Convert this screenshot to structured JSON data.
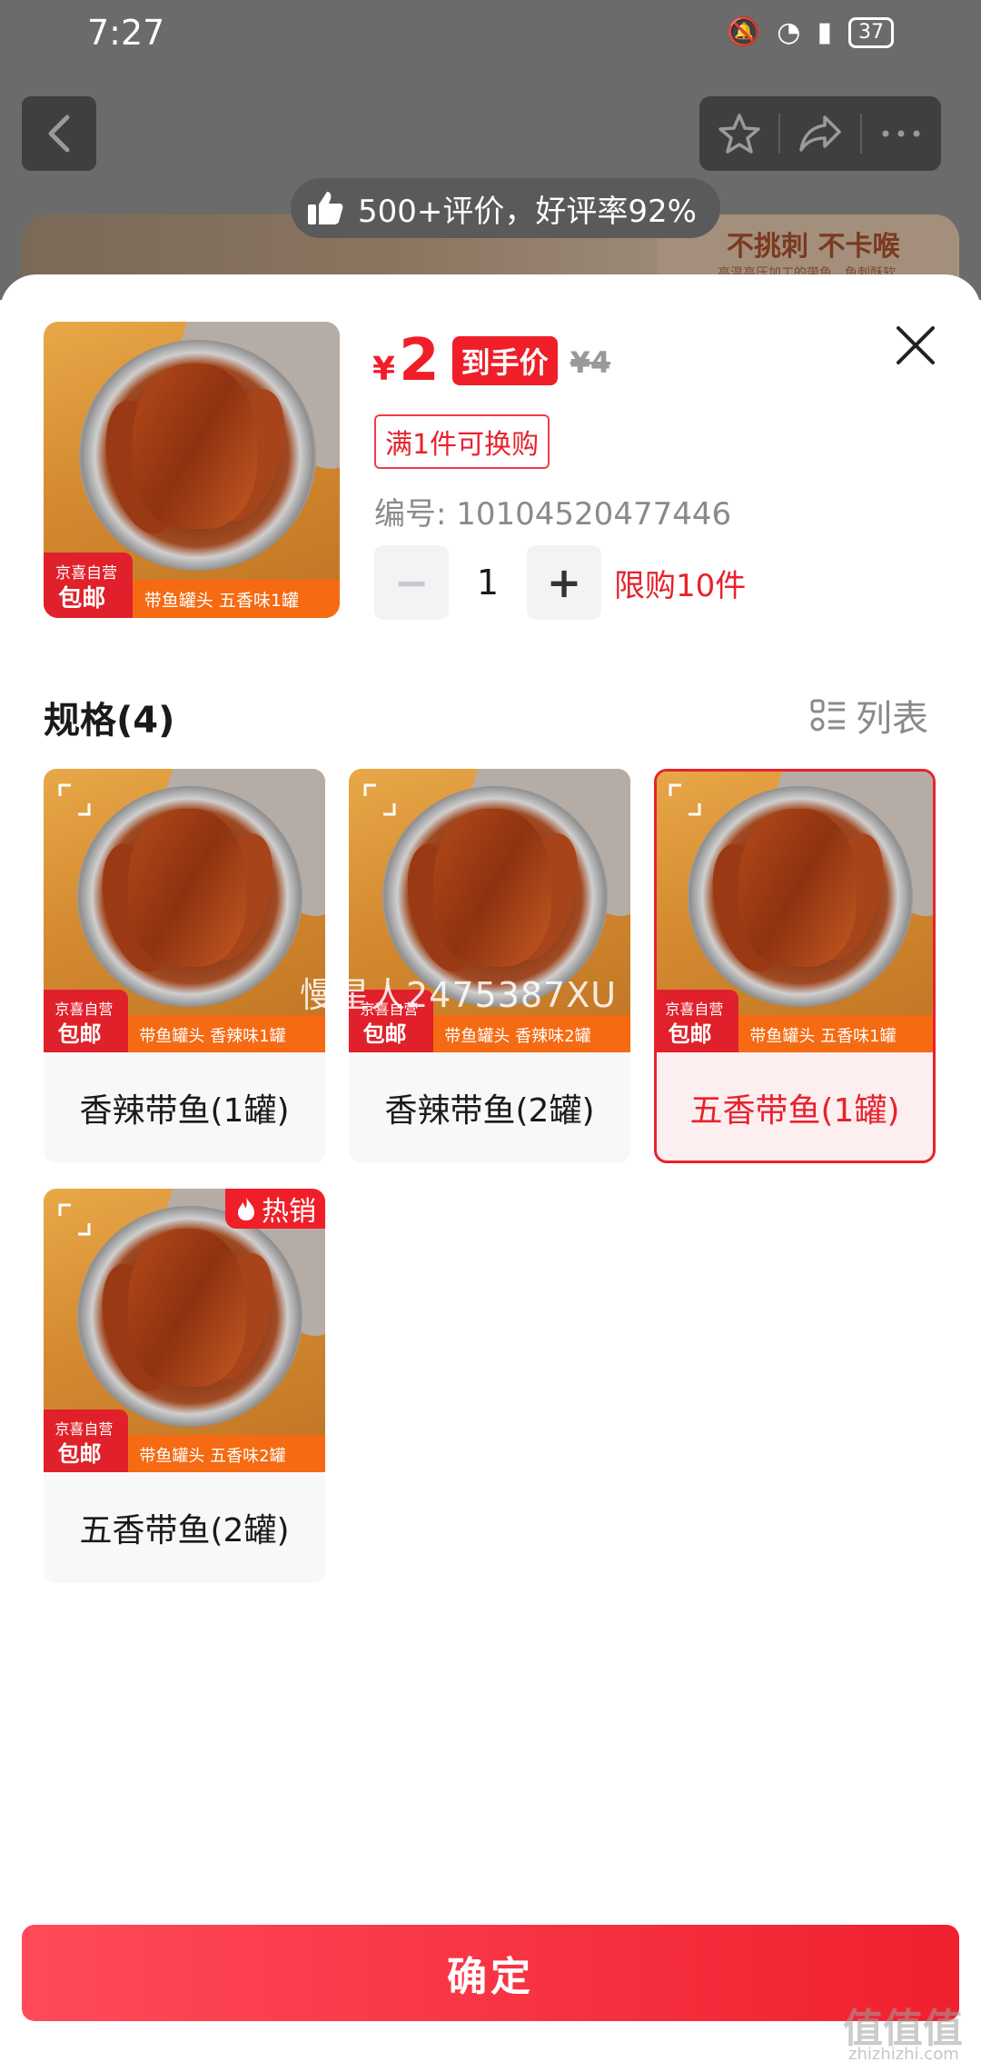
{
  "status_bar": {
    "time": "7:27",
    "battery": "37"
  },
  "background_page": {
    "review_summary": "500+评价，好评率92%",
    "banner_title": "不挑刺 不卡喉",
    "banner_subtitle": "高温高压加工的带鱼，鱼刺酥软"
  },
  "sheet": {
    "price_symbol": "¥",
    "price": "2",
    "price_label": "到手价",
    "original_price": "¥4",
    "promo_tag": "满1件可换购",
    "sku_number": "编号: 10104520477446",
    "quantity": "1",
    "purchase_limit": "限购10件",
    "thumb_badge_top": "京喜自营",
    "thumb_badge_main": "包邮",
    "thumb_strip": "带鱼罐头 五香味1罐"
  },
  "spec": {
    "title": "规格(4)",
    "view_toggle_label": "列表",
    "badge_top": "京喜自营",
    "badge_main": "包邮",
    "hot_badge": "热销",
    "watermark": "慢星人2475387XU",
    "options": [
      {
        "name": "香辣带鱼(1罐)",
        "strip": "带鱼罐头 香辣味1罐",
        "selected": false
      },
      {
        "name": "香辣带鱼(2罐)",
        "strip": "带鱼罐头 香辣味2罐",
        "selected": false
      },
      {
        "name": "五香带鱼(1罐)",
        "strip": "带鱼罐头 五香味1罐",
        "selected": true
      },
      {
        "name": "五香带鱼(2罐)",
        "strip": "带鱼罐头 五香味2罐",
        "selected": false,
        "hot": true
      }
    ]
  },
  "confirm_label": "确定",
  "site_watermark": {
    "main": "值值值",
    "sub": "zhizhizhi.com"
  },
  "colors": {
    "accent": "#f01e28",
    "strip_orange": "#f56a12",
    "selected_bg": "#fdeef0"
  },
  "icons": [
    "back-arrow-icon",
    "star-icon",
    "share-icon",
    "more-icon",
    "thumbs-up-icon",
    "close-icon",
    "list-view-icon",
    "expand-icon",
    "flame-icon"
  ]
}
